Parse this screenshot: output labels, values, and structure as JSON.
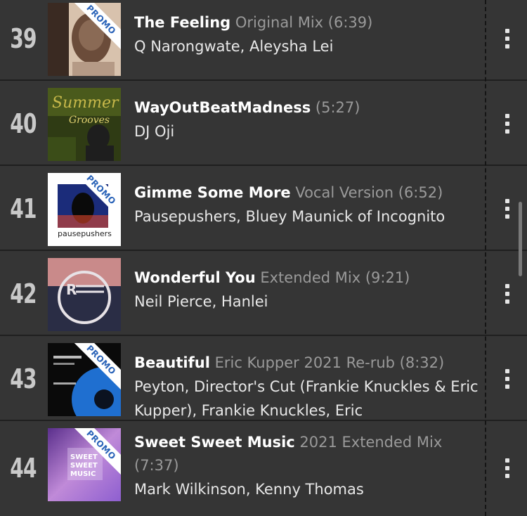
{
  "tracks": [
    {
      "rank": "39",
      "title": "The Feeling",
      "mix": " Original Mix (6:39)",
      "artists": "Q Narongwate, Aleysha Lei",
      "promo": "PROMO",
      "art_colors": [
        "#b59a86",
        "#d8c2ad",
        "#6b4c3a"
      ]
    },
    {
      "rank": "40",
      "title": "WayOutBeatMadness",
      "mix": " (5:27)",
      "artists": "DJ Oji",
      "promo": "",
      "art_colors": [
        "#2f3b14",
        "#6a7a2a",
        "#c7b84a"
      ]
    },
    {
      "rank": "41",
      "title": "Gimme Some More",
      "mix": " Vocal Version (6:52)",
      "artists": "Pausepushers, Bluey Maunick of Incognito",
      "promo": "PROMO",
      "art_colors": [
        "#ffffff",
        "#1b2c7a",
        "#e0462a"
      ]
    },
    {
      "rank": "42",
      "title": "Wonderful You",
      "mix": " Extended Mix (9:21)",
      "artists": "Neil Pierce, Hanlei",
      "promo": "",
      "art_colors": [
        "#2a2d45",
        "#c98a8a",
        "#e7e2e6"
      ]
    },
    {
      "rank": "43",
      "title": "Beautiful",
      "mix": " Eric Kupper 2021 Re-rub (8:32)",
      "artists": "Peyton, Director's Cut (Frankie Knuckles & Eric Kupper), Frankie Knuckles, Eric",
      "promo": "PROMO",
      "art_colors": [
        "#0b1220",
        "#1f6fd0",
        "#0a0a0a"
      ]
    },
    {
      "rank": "44",
      "title": "Sweet Sweet Music",
      "mix": " 2021 Extended Mix (7:37)",
      "artists": "Mark Wilkinson, Kenny Thomas",
      "promo": "PROMO",
      "art_colors": [
        "#8e5fd0",
        "#c08ad8",
        "#5a2f8c"
      ]
    }
  ],
  "menu_icon": "more-vertical-icon"
}
